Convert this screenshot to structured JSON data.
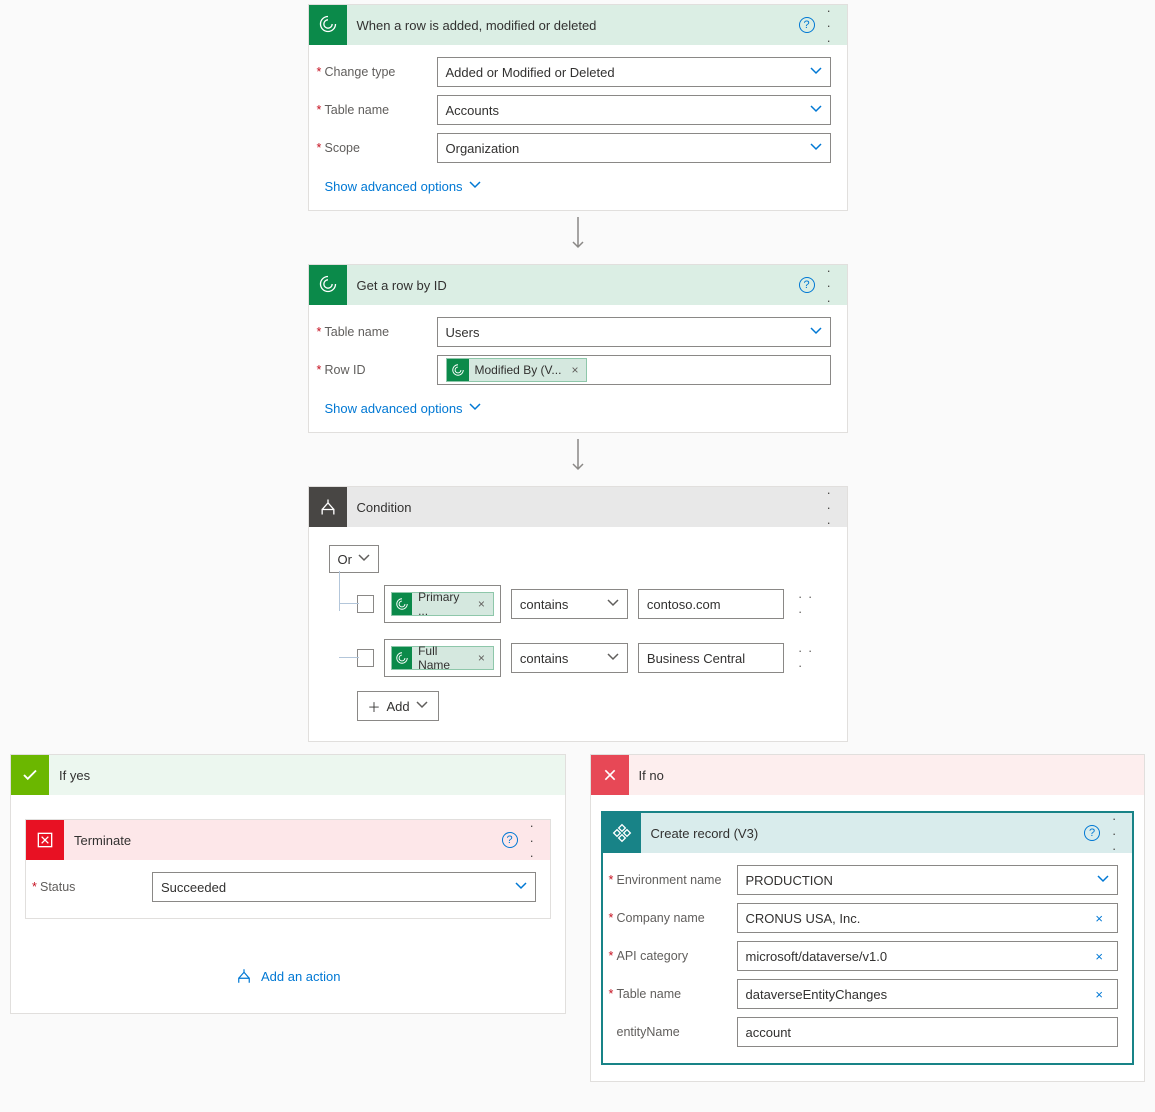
{
  "trigger": {
    "title": "When a row is added, modified or deleted",
    "fields": {
      "change_type": {
        "label": "Change type",
        "value": "Added or Modified or Deleted"
      },
      "table_name": {
        "label": "Table name",
        "value": "Accounts"
      },
      "scope": {
        "label": "Scope",
        "value": "Organization"
      }
    },
    "advanced_link": "Show advanced options"
  },
  "getrow": {
    "title": "Get a row by ID",
    "fields": {
      "table_name": {
        "label": "Table name",
        "value": "Users"
      },
      "row_id": {
        "label": "Row ID"
      }
    },
    "row_id_token": "Modified By (V...",
    "advanced_link": "Show advanced options"
  },
  "condition": {
    "title": "Condition",
    "grouping": "Or",
    "rules": [
      {
        "field_token": "Primary ...",
        "operator": "contains",
        "value": "contoso.com"
      },
      {
        "field_token": "Full Name",
        "operator": "contains",
        "value": "Business Central"
      }
    ],
    "add_label": "Add"
  },
  "yes_branch": {
    "title": "If yes",
    "terminate": {
      "title": "Terminate",
      "status_label": "Status",
      "status_value": "Succeeded"
    },
    "add_action": "Add an action"
  },
  "no_branch": {
    "title": "If no",
    "create": {
      "title": "Create record (V3)",
      "fields": {
        "env": {
          "label": "Environment name",
          "value": "PRODUCTION"
        },
        "company": {
          "label": "Company name",
          "value": "CRONUS USA, Inc."
        },
        "apicat": {
          "label": "API category",
          "value": "microsoft/dataverse/v1.0"
        },
        "table": {
          "label": "Table name",
          "value": "dataverseEntityChanges"
        },
        "entity": {
          "label": "entityName",
          "value": "account"
        }
      }
    }
  }
}
